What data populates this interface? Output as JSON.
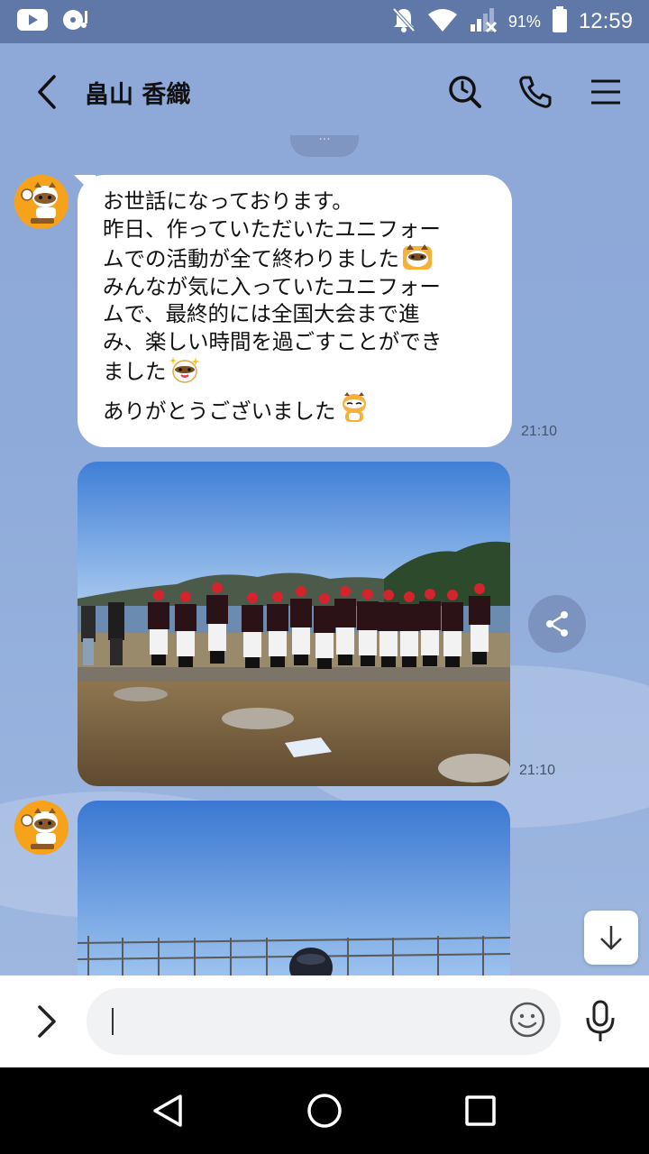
{
  "status_bar": {
    "battery": "91%",
    "time": "12:59",
    "icons": [
      "youtube-icon",
      "music-icon",
      "notifications-off-icon",
      "wifi-icon",
      "signal-icon",
      "battery-icon"
    ]
  },
  "header": {
    "title": "畠山 香織",
    "icons": [
      "back-icon",
      "search-icon",
      "phone-icon",
      "menu-icon"
    ]
  },
  "messages": [
    {
      "type": "text",
      "lines": [
        "お世話になっております。",
        "昨日、作っていただいたユニフォー",
        "ムでの活動が全て終わりました",
        "みんなが気に入っていたユニフォー",
        "ムで、最終的には全国大会まで進",
        "み、楽しい時間を過ごすことができ",
        "ました",
        "ありがとうございました"
      ],
      "stickers": [
        "raccoon-emoji",
        "raccoon-sparkle-emoji",
        "raccoon-bow-emoji"
      ],
      "time": "21:10"
    },
    {
      "type": "photo",
      "subject": "team-photo-beach",
      "time": "21:10"
    },
    {
      "type": "photo",
      "subject": "photo-blue-sky-fence"
    }
  ],
  "input": {
    "placeholder": "",
    "icons": [
      "expand-icon",
      "emoji-icon",
      "mic-icon"
    ]
  },
  "nav": [
    "back-triangle-icon",
    "home-circle-icon",
    "recents-square-icon"
  ]
}
